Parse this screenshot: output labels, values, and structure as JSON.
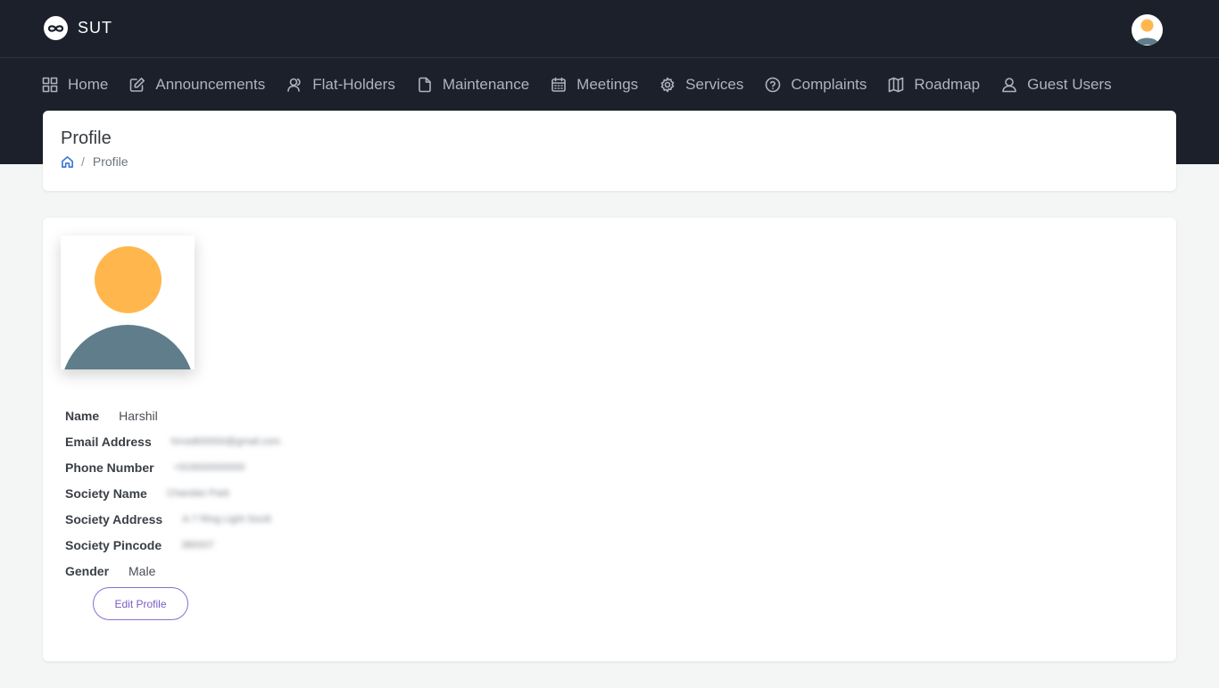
{
  "app": {
    "name": "SUT"
  },
  "nav": [
    {
      "label": "Home",
      "icon": "grid-icon"
    },
    {
      "label": "Announcements",
      "icon": "edit-icon"
    },
    {
      "label": "Flat-Holders",
      "icon": "users-icon"
    },
    {
      "label": "Maintenance",
      "icon": "file-icon"
    },
    {
      "label": "Meetings",
      "icon": "calendar-icon"
    },
    {
      "label": "Services",
      "icon": "gear-icon"
    },
    {
      "label": "Complaints",
      "icon": "help-circle-icon"
    },
    {
      "label": "Roadmap",
      "icon": "map-icon"
    },
    {
      "label": "Guest Users",
      "icon": "user-icon"
    }
  ],
  "header": {
    "title": "Profile",
    "breadcrumb_current": "Profile"
  },
  "profile": {
    "fields": [
      {
        "label": "Name",
        "value": "Harshil"
      },
      {
        "label": "Email Address",
        "value": "hrnsdt00000@gmail.com"
      },
      {
        "label": "Phone Number",
        "value": "+919000000000"
      },
      {
        "label": "Society Name",
        "value": "Chandan Park"
      },
      {
        "label": "Society Address",
        "value": "A-7 Ring Light Sociti"
      },
      {
        "label": "Society Pincode",
        "value": "380007"
      },
      {
        "label": "Gender",
        "value": "Male"
      }
    ],
    "edit_label": "Edit Profile"
  },
  "colors": {
    "navbar_bg": "#1b202b",
    "avatar_head": "#ffb74d",
    "avatar_body": "#607d8b",
    "accent": "#7b5cc4",
    "breadcrumb_icon": "#3a7bd5"
  }
}
